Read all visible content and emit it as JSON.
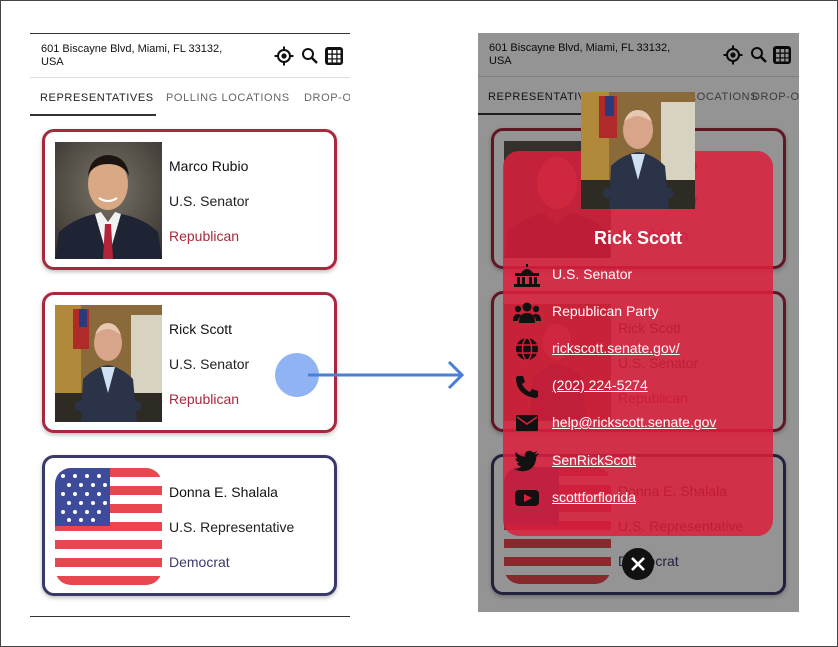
{
  "header": {
    "address": "601 Biscayne Blvd, Miami, FL 33132, USA",
    "icons": [
      "crosshair-icon",
      "search-icon",
      "grid-icon"
    ]
  },
  "tabs": [
    {
      "label": "REPRESENTATIVES",
      "active": true
    },
    {
      "label": "POLLING LOCATIONS",
      "active": false
    },
    {
      "label": "DROP-OFF",
      "active": false
    }
  ],
  "tabs_right_visible": [
    "REPRESENTATIVES",
    "LOCATIONS",
    "DROP-OF"
  ],
  "representatives": [
    {
      "name": "Marco Rubio",
      "office": "U.S. Senator",
      "party": "Republican",
      "party_color": "#a8283d"
    },
    {
      "name": "Rick Scott",
      "office": "U.S. Senator",
      "party": "Republican",
      "party_color": "#a8283d"
    },
    {
      "name": "Donna E. Shalala",
      "office": "U.S. Representative",
      "party": "Democrat",
      "party_color": "#3a3a6a"
    }
  ],
  "detail": {
    "name": "Rick Scott",
    "office": "U.S. Senator",
    "party": "Republican Party",
    "website": "rickscott.senate.gov/",
    "phone": "(202) 224-5274",
    "email": "help@rickscott.senate.gov",
    "twitter": "SenRickScott",
    "youtube": "scottforflorida"
  },
  "colors": {
    "republican": "#a8283d",
    "democrat": "#3a3a6a",
    "modal": "#dc1e3c",
    "tap_indicator": "#8ab0f2",
    "arrow": "#4a7fd8"
  }
}
